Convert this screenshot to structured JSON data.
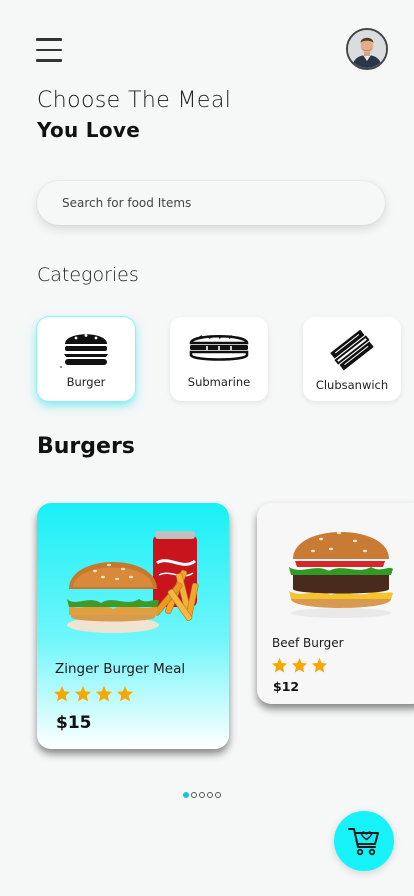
{
  "header": {
    "menu_icon": "hamburger-menu-icon",
    "avatar_icon": "user-avatar"
  },
  "hero": {
    "line1": "Choose The Meal",
    "line2": "You Love"
  },
  "search": {
    "placeholder": "Search for food Items",
    "value": ""
  },
  "categories": {
    "title": "Categories",
    "items": [
      {
        "label": "Burger",
        "icon": "burger-icon",
        "active": true
      },
      {
        "label": "Submarine",
        "icon": "submarine-sandwich-icon",
        "active": false
      },
      {
        "label": "Clubsanwich",
        "icon": "club-sandwich-icon",
        "active": false
      }
    ]
  },
  "section": {
    "title": "Burgers"
  },
  "foods": [
    {
      "name": "Zinger Burger Meal",
      "rating": 4,
      "price": "$15"
    },
    {
      "name": "Beef Burger",
      "rating": 3,
      "price": "$12"
    }
  ],
  "pagination": {
    "total": 5,
    "active": 1
  },
  "cart": {
    "icon": "cart-heart-icon"
  },
  "colors": {
    "accent": "#16f3f8",
    "star": "#f7a800",
    "background": "#f6f7f7"
  }
}
